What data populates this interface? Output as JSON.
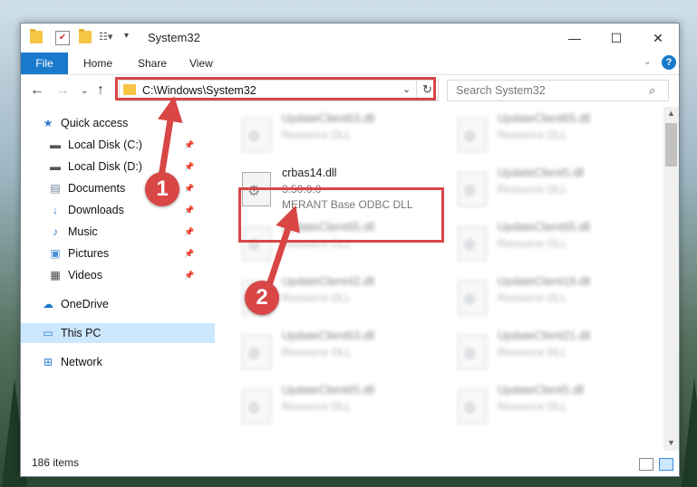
{
  "window": {
    "title": "System32",
    "controls": {
      "minimize": "—",
      "maximize": "☐",
      "close": "✕"
    }
  },
  "ribbon": {
    "tabs": [
      "File",
      "Home",
      "Share",
      "View"
    ],
    "help": "?"
  },
  "nav": {
    "address": "C:\\Windows\\System32",
    "search_placeholder": "Search System32"
  },
  "sidebar": {
    "items": [
      {
        "label": "Quick access",
        "icon": "star-icon",
        "pinned": false
      },
      {
        "label": "Local Disk (C:)",
        "icon": "drive-icon",
        "pinned": true
      },
      {
        "label": "Local Disk (D:)",
        "icon": "drive-icon",
        "pinned": true
      },
      {
        "label": "Documents",
        "icon": "documents-icon",
        "pinned": true
      },
      {
        "label": "Downloads",
        "icon": "download-icon",
        "pinned": true
      },
      {
        "label": "Music",
        "icon": "music-icon",
        "pinned": true
      },
      {
        "label": "Pictures",
        "icon": "pictures-icon",
        "pinned": true
      },
      {
        "label": "Videos",
        "icon": "videos-icon",
        "pinned": true
      },
      {
        "label": "OneDrive",
        "icon": "cloud-icon",
        "pinned": false
      },
      {
        "label": "This PC",
        "icon": "computer-icon",
        "pinned": false,
        "selected": true
      },
      {
        "label": "Network",
        "icon": "network-icon",
        "pinned": false
      }
    ]
  },
  "files": {
    "highlighted": {
      "name": "crbas14.dll",
      "version": "3.50.0.0",
      "description": "MERANT Base ODBC DLL"
    },
    "blurred": [
      {
        "name": "UpdateClient63.dll",
        "type": "Resource DLL"
      },
      {
        "name": "UpdateClient65.dll",
        "type": "Resource DLL"
      },
      {
        "name": "UpdateClient5.dll",
        "type": "Resource DLL"
      },
      {
        "name": "UpdateClient65.dll",
        "type": "Resource DLL"
      },
      {
        "name": "UpdateClient65.dll",
        "type": "Resource DLL"
      },
      {
        "name": "UpdateClient42.dll",
        "type": "Resource DLL"
      },
      {
        "name": "UpdateClient19.dll",
        "type": "Resource DLL"
      },
      {
        "name": "UpdateClient63.dll",
        "type": "Resource DLL"
      },
      {
        "name": "UpdateClient21.dll",
        "type": "Resource DLL"
      },
      {
        "name": "UpdateClient65.dll",
        "type": "Resource DLL"
      },
      {
        "name": "UpdateClient5.dll",
        "type": "Resource DLL"
      }
    ]
  },
  "status": {
    "item_count": "186 items"
  },
  "annotations": {
    "step1": "1",
    "step2": "2",
    "color": "#d94646"
  }
}
